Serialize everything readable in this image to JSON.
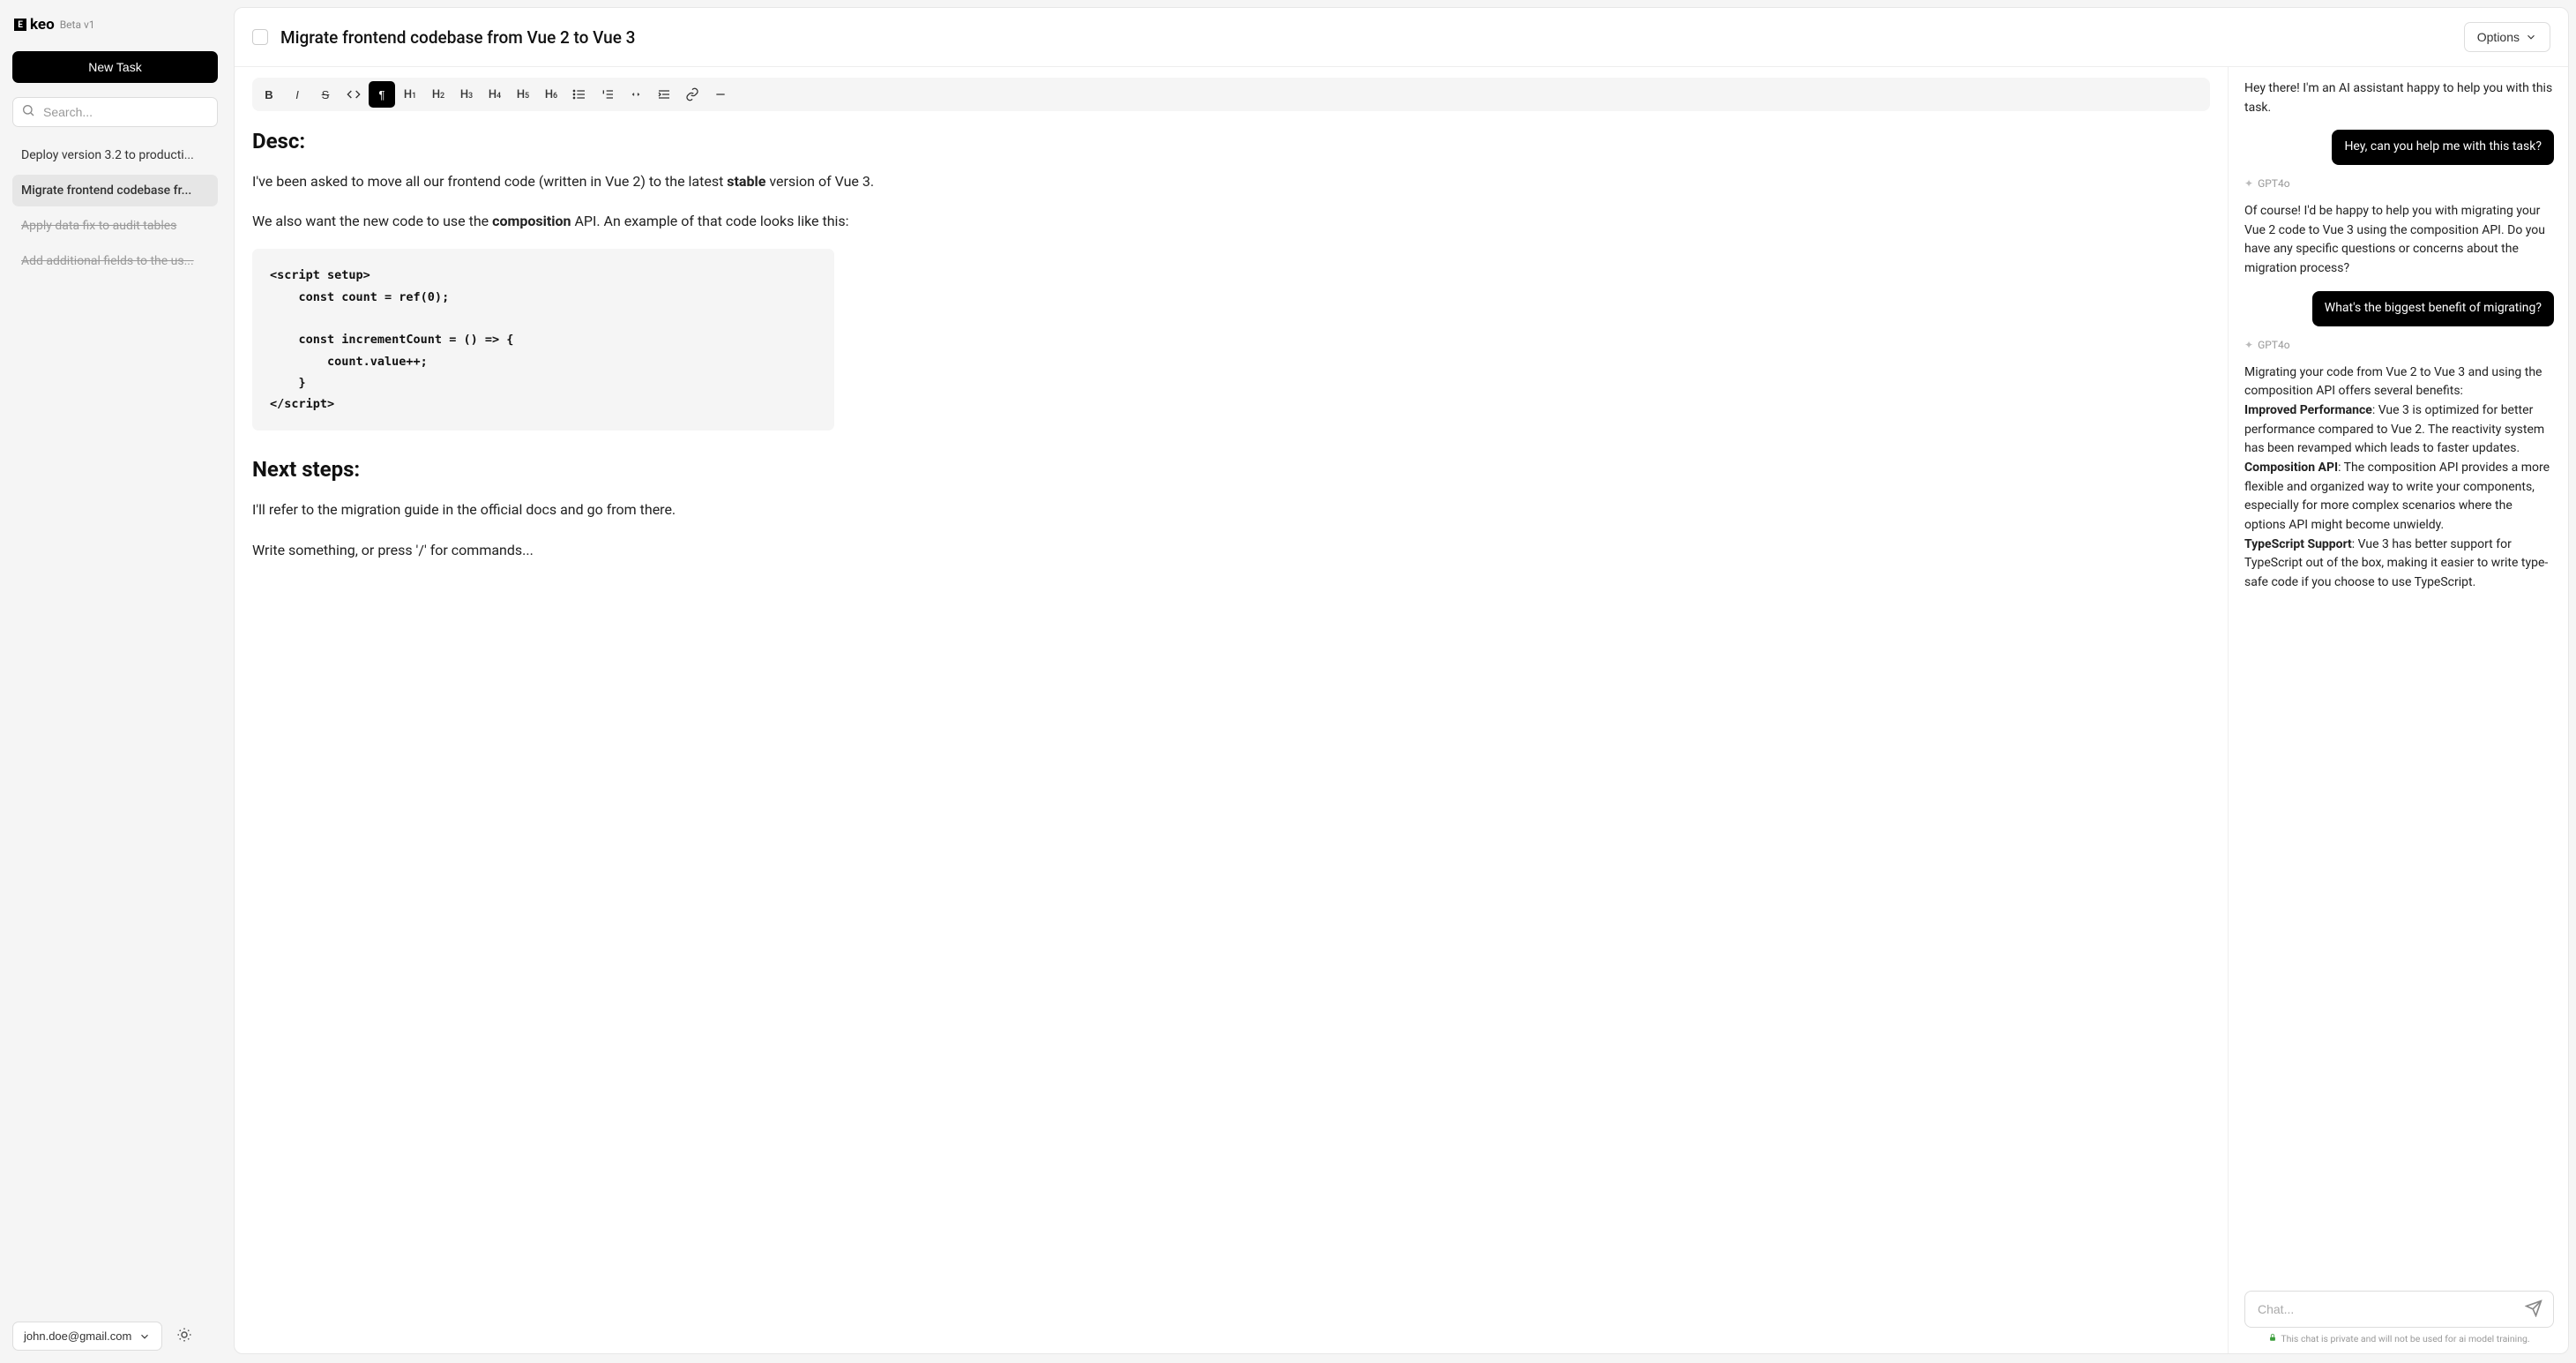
{
  "logo": {
    "text": "keo",
    "badge": "Beta v1"
  },
  "sidebar": {
    "new_task_label": "New Task",
    "search_placeholder": "Search...",
    "tasks": [
      {
        "label": "Deploy version 3.2 to producti...",
        "active": false,
        "strike": false
      },
      {
        "label": "Migrate frontend codebase fr...",
        "active": true,
        "strike": false
      },
      {
        "label": "Apply data fix to audit tables",
        "active": false,
        "strike": true
      },
      {
        "label": "Add additional fields to the us...",
        "active": false,
        "strike": true
      }
    ],
    "user_email": "john.doe@gmail.com"
  },
  "header": {
    "title": "Migrate frontend codebase from Vue 2 to Vue 3",
    "options_label": "Options"
  },
  "toolbar": {
    "items": [
      "B",
      "I",
      "S",
      "</>",
      "¶",
      "H1",
      "H2",
      "H3",
      "H4",
      "H5",
      "H6",
      "ul",
      "ol",
      "quo",
      "ind",
      "link",
      "hr"
    ],
    "active_index": 4
  },
  "doc": {
    "h1": "Desc:",
    "p1_pre": "I've been asked to move all our frontend code (written in Vue 2) to the latest ",
    "p1_bold": "stable",
    "p1_post": " version of Vue 3.",
    "p2_pre": "We also want the new code to use the ",
    "p2_bold": "composition",
    "p2_post": " API. An example of that code looks like this:",
    "code": "<script setup>\n    const count = ref(0);\n\n    const incrementCount = () => {\n        count.value++;\n    }\n</script>",
    "h2": "Next steps:",
    "p3": "I'll refer to the migration guide in the official docs and go from there.",
    "placeholder": "Write something, or press '/' for commands..."
  },
  "chat": {
    "intro": "Hey there! I'm an AI assistant happy to help you with this task.",
    "user1": "Hey, can you help me with this task?",
    "model_label": "GPT4o",
    "assist1": "Of course! I'd be happy to help you with migrating your Vue 2 code to Vue 3 using the composition API. Do you have any specific questions or concerns about the migration process?",
    "user2": "What's the biggest benefit of migrating?",
    "assist2_intro": "Migrating your code from Vue 2 to Vue 3 and using the composition API offers several benefits:",
    "b1_t": "Improved Performance",
    "b1_b": ": Vue 3 is optimized for better performance compared to Vue 2. The reactivity system has been revamped which leads to faster updates.",
    "b2_t": "Composition API",
    "b2_b": ": The composition API provides a more flexible and organized way to write your components, especially for more complex scenarios where the options API might become unwieldy.",
    "b3_t": "TypeScript Support",
    "b3_b": ": Vue 3 has better support for TypeScript out of the box, making it easier to write type-safe code if you choose to use TypeScript.",
    "input_placeholder": "Chat...",
    "disclaimer": "This chat is private and will not be used for ai model training."
  }
}
